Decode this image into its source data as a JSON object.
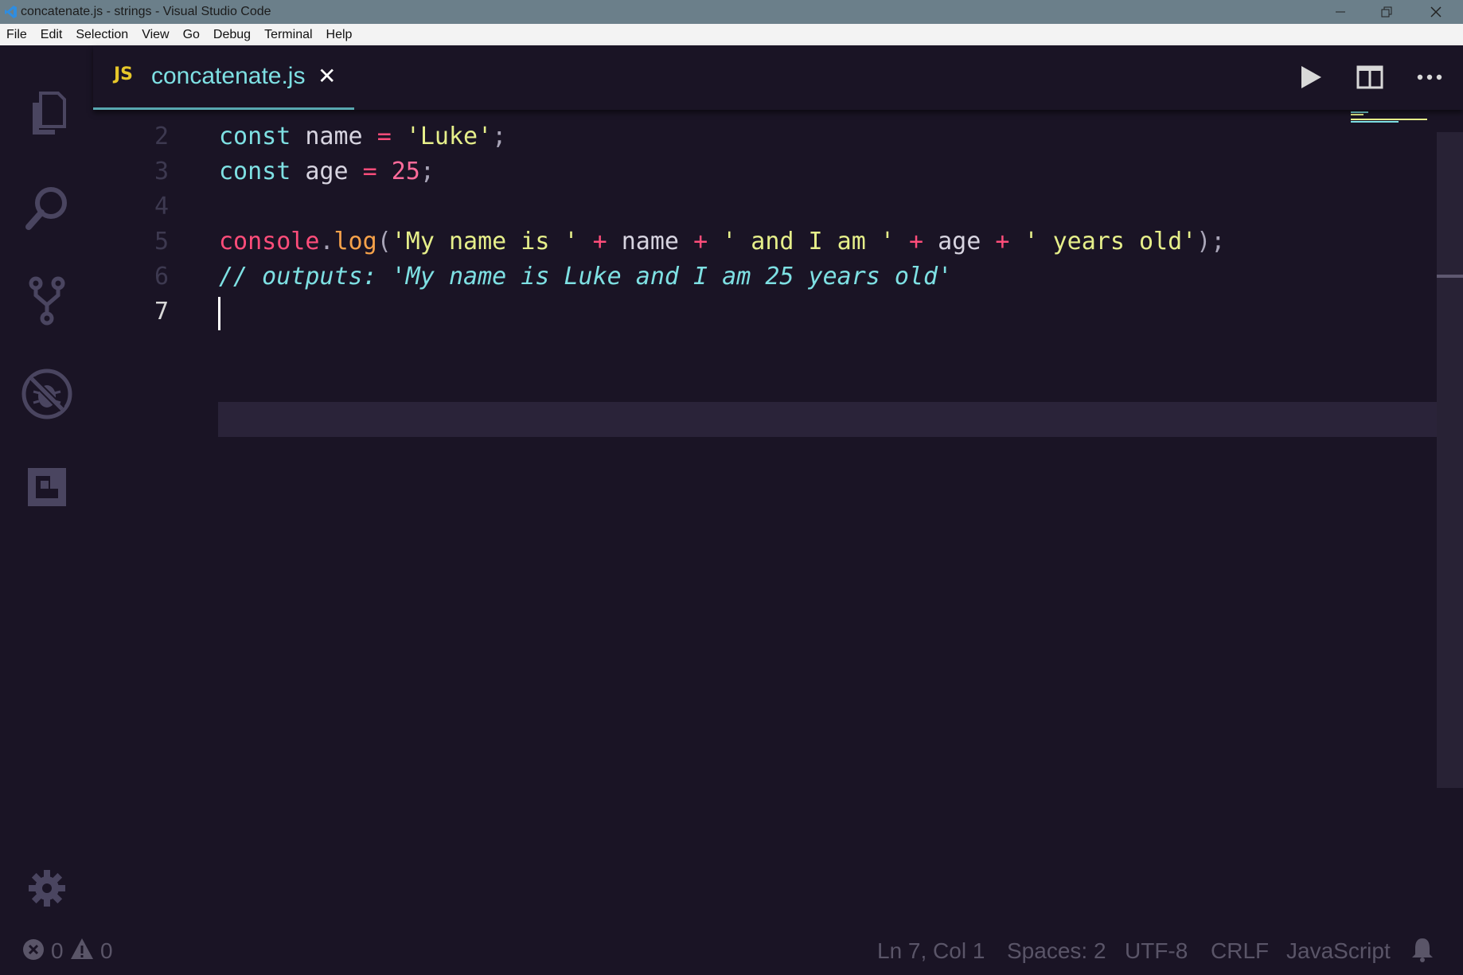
{
  "window": {
    "title": "concatenate.js - strings - Visual Studio Code"
  },
  "menu": [
    {
      "label": "File"
    },
    {
      "label": "Edit"
    },
    {
      "label": "Selection"
    },
    {
      "label": "View"
    },
    {
      "label": "Go"
    },
    {
      "label": "Debug"
    },
    {
      "label": "Terminal"
    },
    {
      "label": "Help"
    }
  ],
  "activity_bar": {
    "icons": [
      "explorer-icon",
      "search-icon",
      "source-control-icon",
      "debug-icon",
      "extensions-icon",
      "gear-icon"
    ]
  },
  "tab": {
    "badge": "JS",
    "filename": "concatenate.js",
    "close": "✕"
  },
  "editor": {
    "lines": [
      {
        "number": "2",
        "text": "const name = 'Luke';"
      },
      {
        "number": "3",
        "text": "const age = 25;"
      },
      {
        "number": "4",
        "text": ""
      },
      {
        "number": "5",
        "text": "console.log('My name is ' + name + ' and I am ' + age + ' years old');"
      },
      {
        "number": "6",
        "text": "// outputs: 'My name is Luke and I am 25 years old'"
      },
      {
        "number": "7",
        "text": ""
      }
    ],
    "active_line": "7"
  },
  "status": {
    "errors": "0",
    "warnings": "0",
    "position": "Ln 7, Col 1",
    "spaces": "Spaces: 2",
    "encoding": "UTF-8",
    "eol": "CRLF",
    "language": "JavaScript"
  },
  "colors": {
    "background": "#1a1425",
    "keyword": "#7ee0e3",
    "string": "#e6ef8a",
    "operator": "#ff4d7a",
    "function": "#f7a24a",
    "accent_tab": "#58a8b0"
  }
}
